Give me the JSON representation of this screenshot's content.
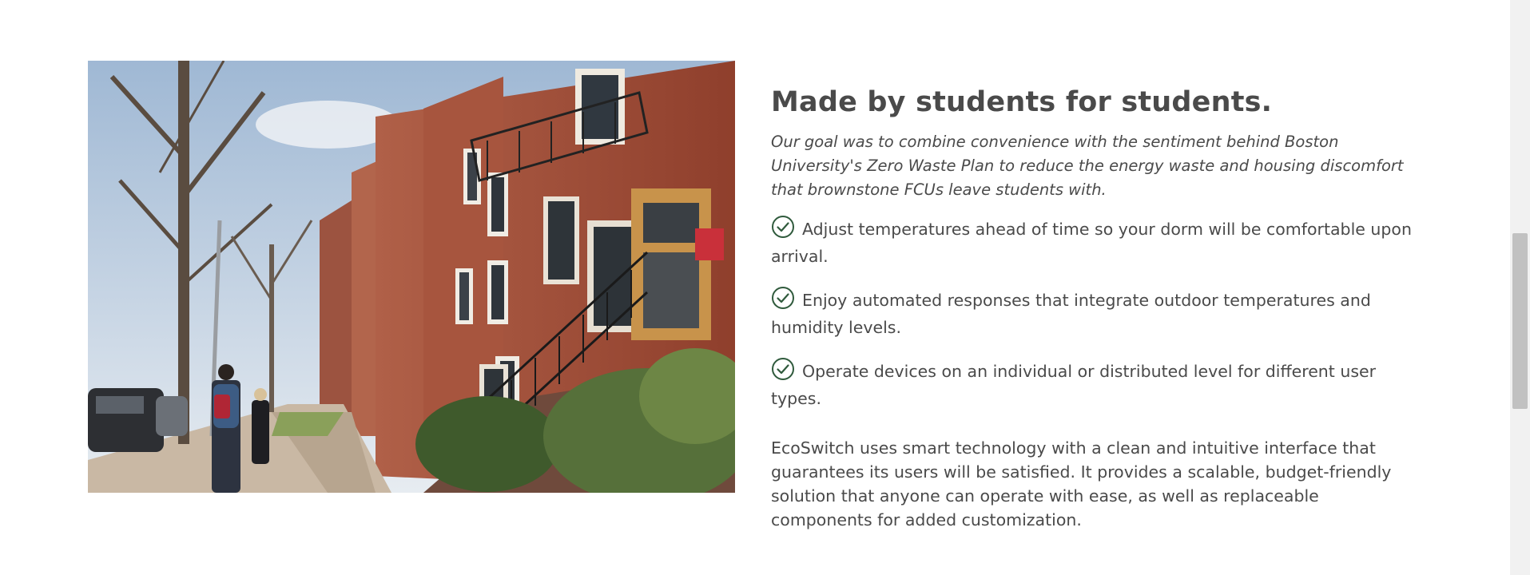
{
  "hero_image": {
    "alt": "Students walking past Boston brownstones"
  },
  "section": {
    "headline": "Made by students for students.",
    "intro": "Our goal was to combine convenience with the sentiment behind Boston University's Zero Waste Plan to reduce the energy waste and housing discomfort that brownstone FCUs leave students with.",
    "features": [
      {
        "icon": "check-circle-icon",
        "text": "Adjust temperatures ahead of time so your dorm will be comfortable upon arrival."
      },
      {
        "icon": "check-circle-icon",
        "text": "Enjoy automated responses that integrate outdoor temperatures and humidity levels."
      },
      {
        "icon": "check-circle-icon",
        "text": "Operate devices on an individual or distributed level for different user types."
      }
    ],
    "summary": "EcoSwitch uses smart technology with a clean and intuitive interface that guarantees its users will be satisfied. It provides a scalable, budget-friendly solution that anyone can operate with ease, as well as replaceable components for added customization."
  },
  "colors": {
    "text": "#4a4a4a",
    "check_icon": "#2f5a3c",
    "brick": "#9a4a35",
    "sky": "#cfdce8"
  }
}
